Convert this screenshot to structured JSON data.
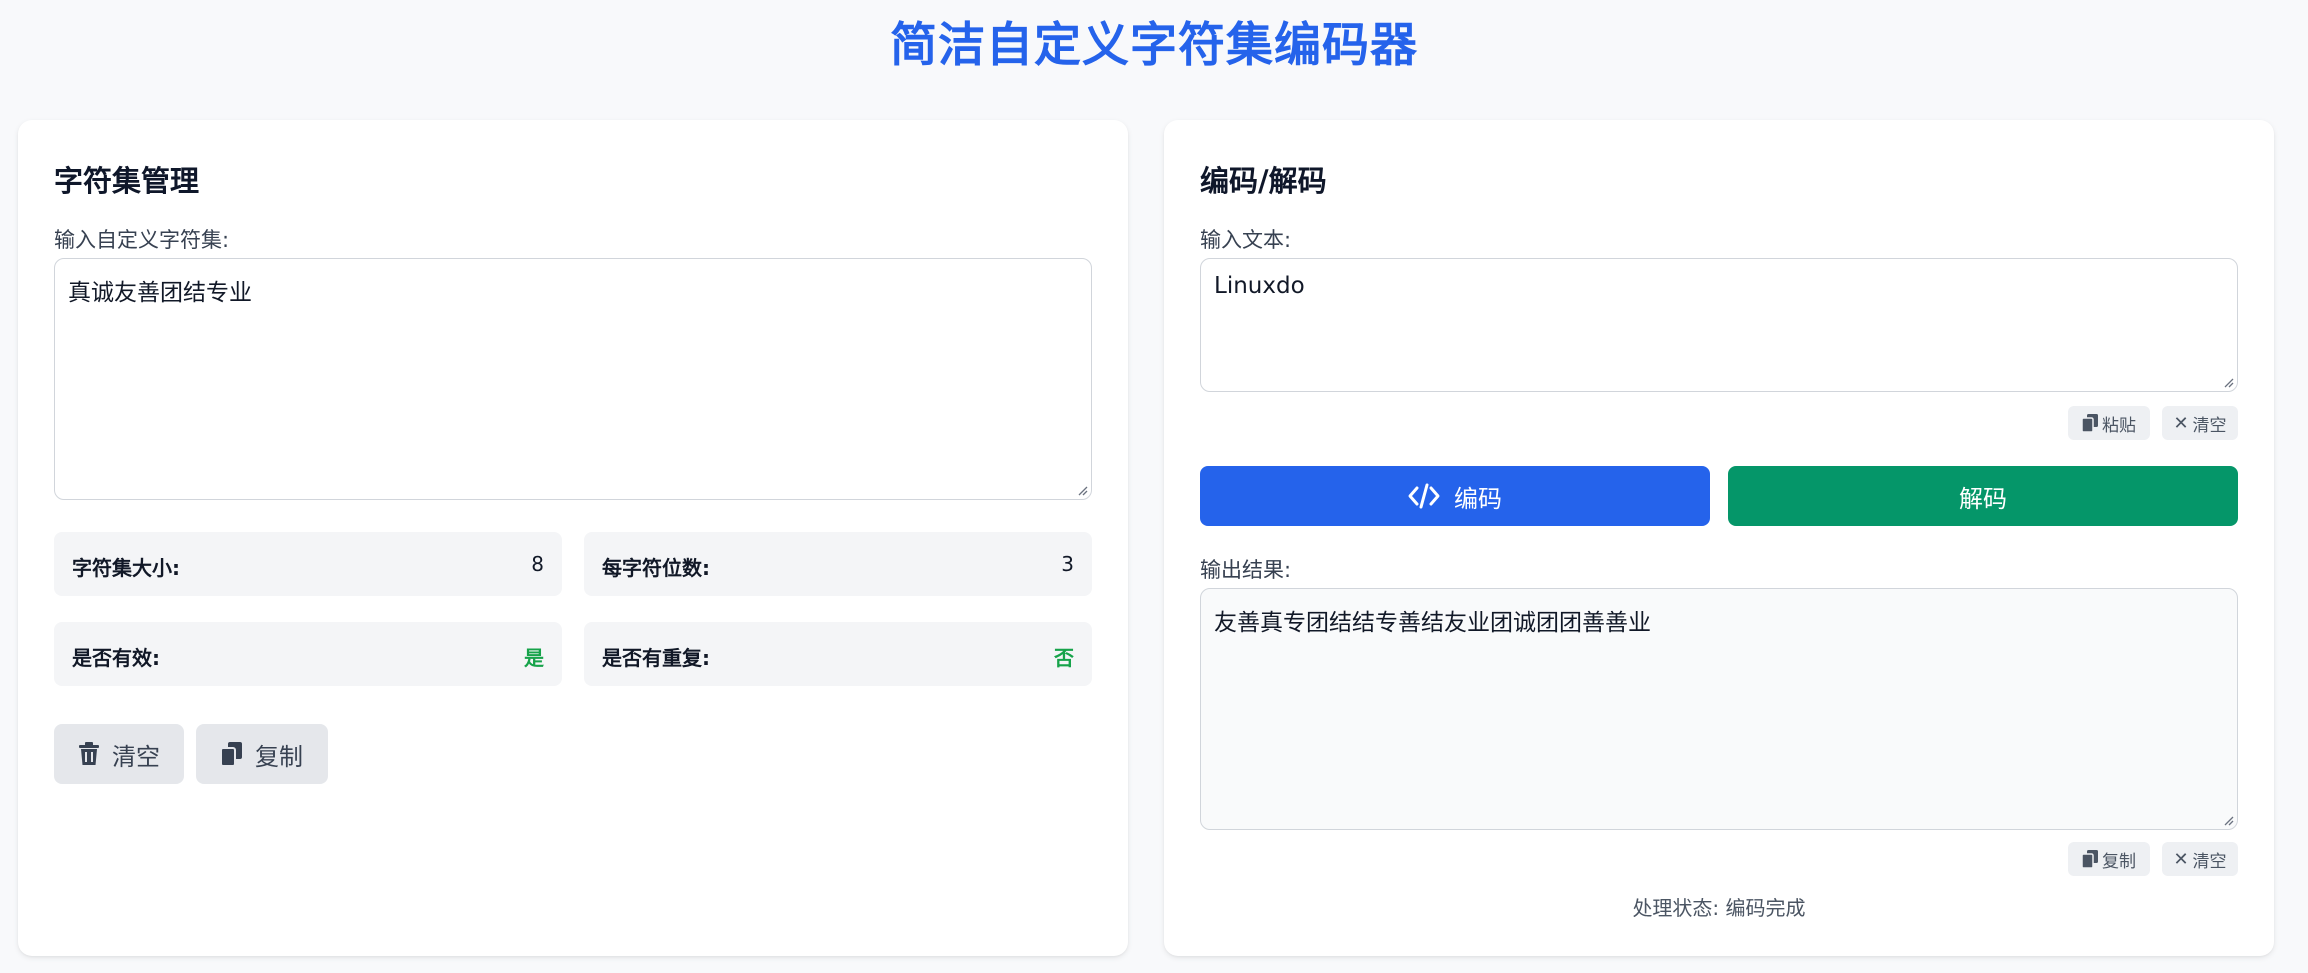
{
  "page": {
    "title": "简洁自定义字符集编码器"
  },
  "charset_panel": {
    "title": "字符集管理",
    "input_label": "输入自定义字符集:",
    "input_value": "真诚友善团结专业",
    "stats": {
      "size_label": "字符集大小:",
      "size_value": "8",
      "bits_label": "每字符位数:",
      "bits_value": "3",
      "valid_label": "是否有效:",
      "valid_value": "是",
      "dup_label": "是否有重复:",
      "dup_value": "否"
    },
    "clear_label": "清空",
    "copy_label": "复制"
  },
  "codec_panel": {
    "title": "编码/解码",
    "input_label": "输入文本:",
    "input_value": "Linuxdo",
    "paste_label": "粘贴",
    "input_clear_label": "清空",
    "encode_label": "编码",
    "decode_label": "解码",
    "output_label": "输出结果:",
    "output_value": "友善真专团结结专善结友业团诚团团善善业",
    "output_copy_label": "复制",
    "output_clear_label": "清空",
    "status_text": "处理状态: 编码完成"
  },
  "colors": {
    "accent": "#2563eb",
    "encode_button": "#2563eb",
    "decode_button": "#059669",
    "positive": "#16a34a"
  },
  "icons": [
    "trash-icon",
    "copy-icon",
    "paste-icon",
    "close-icon",
    "code-icon"
  ]
}
